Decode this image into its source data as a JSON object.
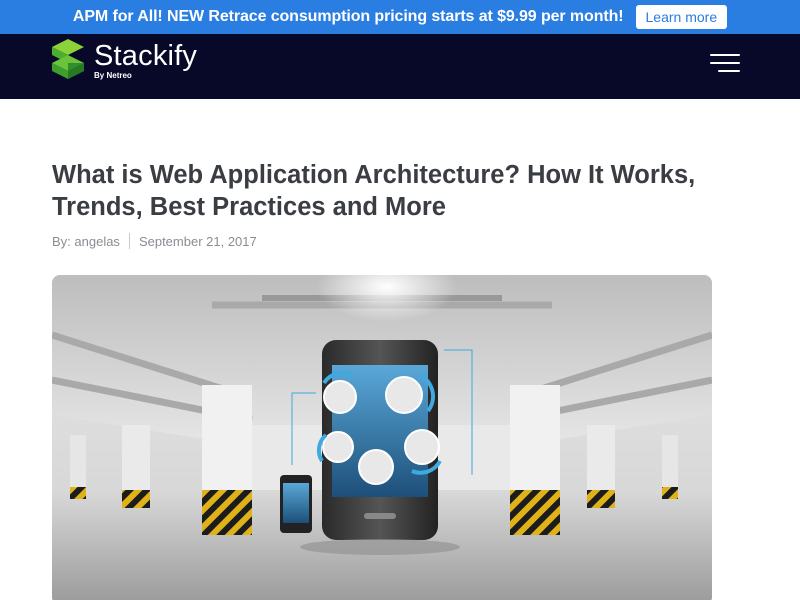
{
  "promo": {
    "text": "APM for All! NEW Retrace consumption pricing starts at $9.99 per month!",
    "button_label": "Learn more",
    "color": "#2a7de1"
  },
  "navbar": {
    "logo_name": "Stackify",
    "logo_by": "By",
    "logo_brand": "Netreo",
    "menu_icon": "hamburger-menu-icon",
    "background": "#080828"
  },
  "article": {
    "title": "What is Web Application Architecture? How It Works, Trends, Best Practices and More",
    "author": "By: angelas",
    "date": "September 21, 2017"
  },
  "hero_image": {
    "description_icon": "hero-image"
  }
}
